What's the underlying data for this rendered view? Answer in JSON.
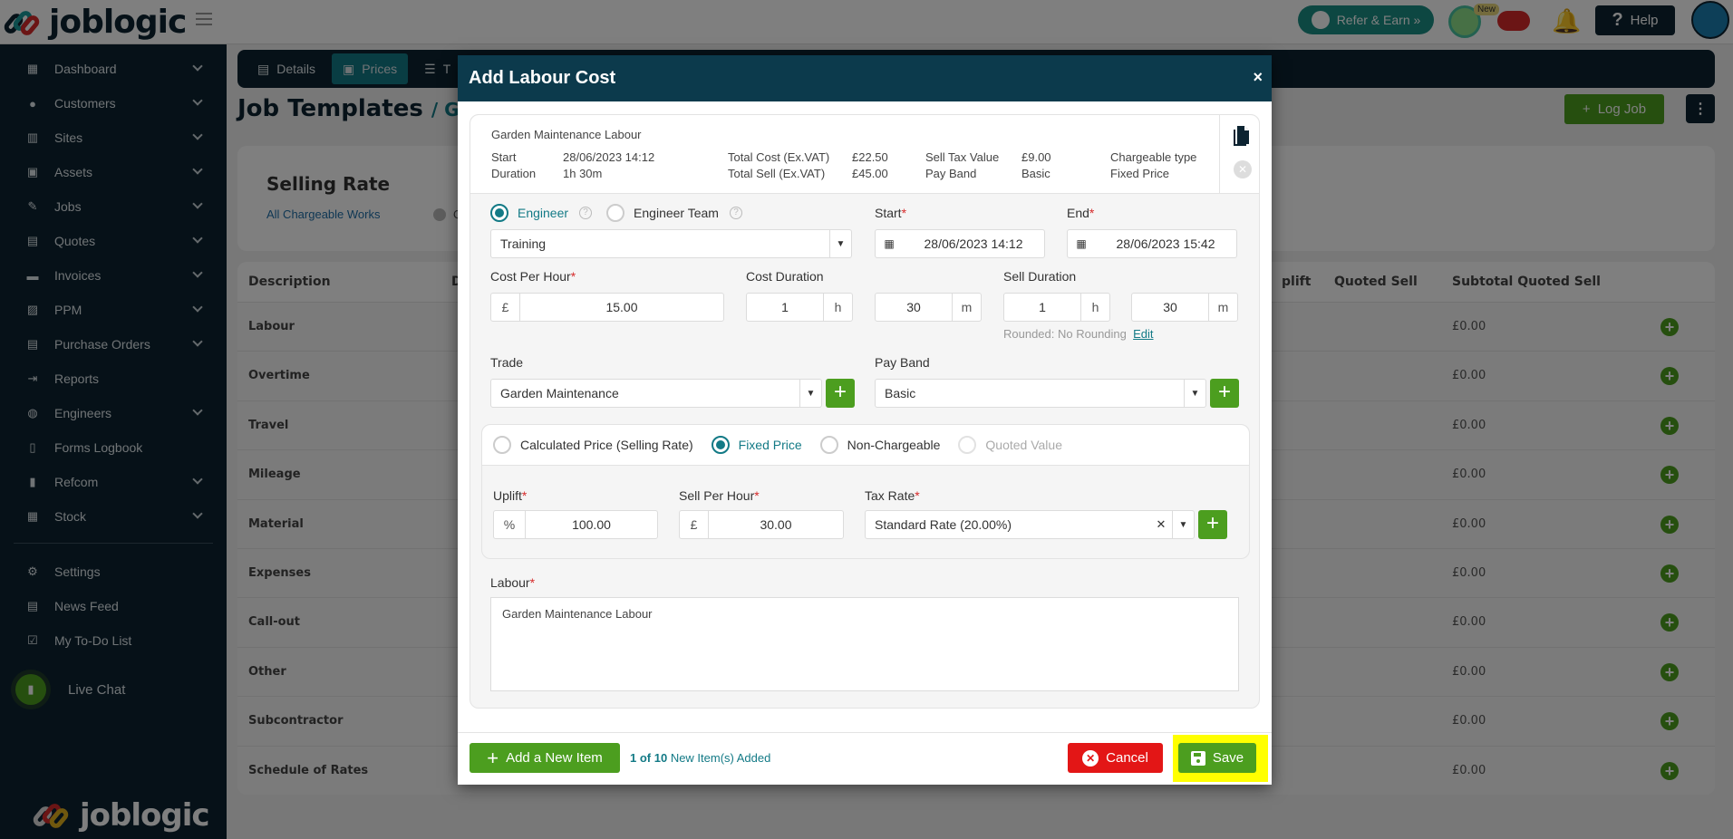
{
  "app": {
    "brand": "joblogic"
  },
  "topbar": {
    "refer_label": "Refer & Earn »",
    "new_badge": "New",
    "help_label": "Help"
  },
  "sidebar": {
    "items": [
      {
        "label": "Dashboard",
        "icon": "dashboard-icon",
        "has_children": true
      },
      {
        "label": "Customers",
        "icon": "user-icon",
        "has_children": true
      },
      {
        "label": "Sites",
        "icon": "building-icon",
        "has_children": true
      },
      {
        "label": "Assets",
        "icon": "asset-icon",
        "has_children": true
      },
      {
        "label": "Jobs",
        "icon": "wrench-icon",
        "has_children": true
      },
      {
        "label": "Quotes",
        "icon": "clipboard-icon",
        "has_children": true
      },
      {
        "label": "Invoices",
        "icon": "card-icon",
        "has_children": true
      },
      {
        "label": "PPM",
        "icon": "calendar-check-icon",
        "has_children": true
      },
      {
        "label": "Purchase Orders",
        "icon": "document-icon",
        "has_children": true
      },
      {
        "label": "Reports",
        "icon": "export-icon",
        "has_children": false
      },
      {
        "label": "Engineers",
        "icon": "users-icon",
        "has_children": true
      },
      {
        "label": "Forms Logbook",
        "icon": "book-icon",
        "has_children": false
      },
      {
        "label": "Refcom",
        "icon": "cylinder-icon",
        "has_children": true
      },
      {
        "label": "Stock",
        "icon": "warehouse-icon",
        "has_children": true
      }
    ],
    "bottom_items": [
      {
        "label": "Settings",
        "icon": "user-cog-icon"
      },
      {
        "label": "News Feed",
        "icon": "newspaper-icon"
      },
      {
        "label": "My To-Do List",
        "icon": "clipboard-check-icon"
      }
    ],
    "live_chat": "Live Chat"
  },
  "page": {
    "tabs": [
      {
        "label": "Details",
        "active": false
      },
      {
        "label": "Prices",
        "active": true
      },
      {
        "label": "T",
        "active": false
      }
    ],
    "title": "Job Templates",
    "breadcrumb": "/ Garden",
    "log_job": "Log Job",
    "selling_rate": {
      "title": "Selling Rate",
      "subtitle": "All Chargeable Works",
      "info_text": "Qu"
    },
    "table": {
      "headers": [
        "Description",
        "Da",
        "plift",
        "Quoted Sell",
        "Subtotal Quoted Sell"
      ],
      "rows": [
        {
          "description": "Labour",
          "subtotal": "£0.00"
        },
        {
          "description": "Overtime",
          "subtotal": "£0.00"
        },
        {
          "description": "Travel",
          "subtotal": "£0.00"
        },
        {
          "description": "Mileage",
          "subtotal": "£0.00"
        },
        {
          "description": "Material",
          "subtotal": "£0.00"
        },
        {
          "description": "Expenses",
          "subtotal": "£0.00"
        },
        {
          "description": "Call-out",
          "subtotal": "£0.00"
        },
        {
          "description": "Other",
          "subtotal": "£0.00"
        },
        {
          "description": "Subcontractor",
          "subtotal": "£0.00"
        },
        {
          "description": "Schedule of Rates",
          "subtotal": "£0.00"
        }
      ]
    }
  },
  "modal": {
    "title": "Add Labour Cost",
    "close": "×",
    "summary": {
      "name": "Garden Maintenance Labour",
      "start_label": "Start",
      "start_value": "28/06/2023 14:12",
      "duration_label": "Duration",
      "duration_value": "1h 30m",
      "total_cost_label": "Total Cost (Ex.VAT)",
      "total_cost_value": "£22.50",
      "total_sell_label": "Total Sell (Ex.VAT)",
      "total_sell_value": "£45.00",
      "sell_tax_label": "Sell Tax Value",
      "sell_tax_value": "£9.00",
      "pay_band_label": "Pay Band",
      "pay_band_value": "Basic",
      "chargeable_type_label": "Chargeable type",
      "chargeable_type_value": "Fixed Price"
    },
    "assign": {
      "engineer_label": "Engineer",
      "engineer_team_label": "Engineer Team",
      "selected": "engineer",
      "engineer_value": "Training"
    },
    "start": {
      "label": "Start",
      "value": "28/06/2023 14:12"
    },
    "end": {
      "label": "End",
      "value": "28/06/2023 15:42"
    },
    "cost_per_hour": {
      "label": "Cost Per Hour",
      "prefix": "£",
      "value": "15.00"
    },
    "cost_duration": {
      "label": "Cost Duration",
      "hours": "1",
      "hours_unit": "h",
      "minutes": "30",
      "minutes_unit": "m"
    },
    "sell_duration": {
      "label": "Sell Duration",
      "hours": "1",
      "hours_unit": "h",
      "minutes": "30",
      "minutes_unit": "m",
      "rounding": "Rounded: No Rounding",
      "edit": "Edit"
    },
    "trade": {
      "label": "Trade",
      "value": "Garden Maintenance"
    },
    "pay_band": {
      "label": "Pay Band",
      "value": "Basic"
    },
    "pricing": {
      "options": [
        {
          "label": "Calculated Price (Selling Rate)",
          "selected": false,
          "disabled": false
        },
        {
          "label": "Fixed Price",
          "selected": true,
          "disabled": false
        },
        {
          "label": "Non-Chargeable",
          "selected": false,
          "disabled": false
        },
        {
          "label": "Quoted Value",
          "selected": false,
          "disabled": true
        }
      ],
      "uplift": {
        "label": "Uplift",
        "prefix": "%",
        "value": "100.00"
      },
      "sell_per_hour": {
        "label": "Sell Per Hour",
        "prefix": "£",
        "value": "30.00"
      },
      "tax_rate": {
        "label": "Tax Rate",
        "value": "Standard Rate (20.00%)"
      }
    },
    "labour": {
      "label": "Labour",
      "value": "Garden Maintenance Labour"
    },
    "footer": {
      "add_item": "Add a New Item",
      "count": "1 of 10",
      "count_suffix": "New Item(s) Added",
      "cancel": "Cancel",
      "save": "Save"
    }
  },
  "colors": {
    "brand_dark": "#0c2331",
    "teal": "#137a86",
    "green": "#4c9e1f",
    "red": "#e31616",
    "highlight": "#ffff00"
  }
}
